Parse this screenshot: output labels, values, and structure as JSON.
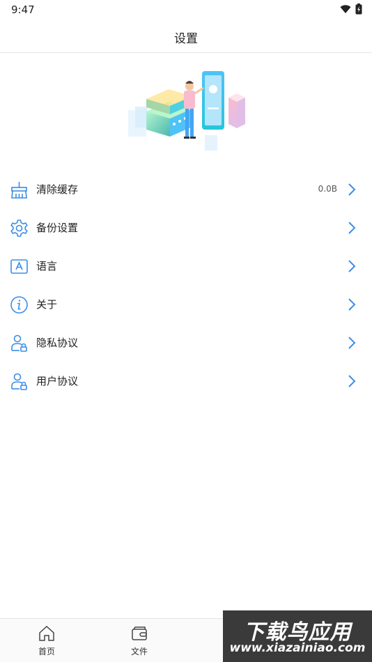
{
  "status_bar": {
    "time": "9:47"
  },
  "header": {
    "title": "设置"
  },
  "settings": [
    {
      "label": "清除缓存",
      "value": "0.0B",
      "icon": "broom-icon"
    },
    {
      "label": "备份设置",
      "value": "",
      "icon": "gear-icon"
    },
    {
      "label": "语言",
      "value": "",
      "icon": "language-icon"
    },
    {
      "label": "关于",
      "value": "",
      "icon": "info-icon"
    },
    {
      "label": "隐私协议",
      "value": "",
      "icon": "user-lock-icon"
    },
    {
      "label": "用户协议",
      "value": "",
      "icon": "user-lock-icon"
    }
  ],
  "tabs": [
    {
      "label": "首页",
      "icon": "home-icon"
    },
    {
      "label": "文件",
      "icon": "wallet-icon"
    }
  ],
  "watermark": {
    "main": "下载鸟应用",
    "sub": "www.xiazainiao.com"
  },
  "colors": {
    "accent": "#3a8ee6",
    "divider": "#e6e6e6"
  }
}
